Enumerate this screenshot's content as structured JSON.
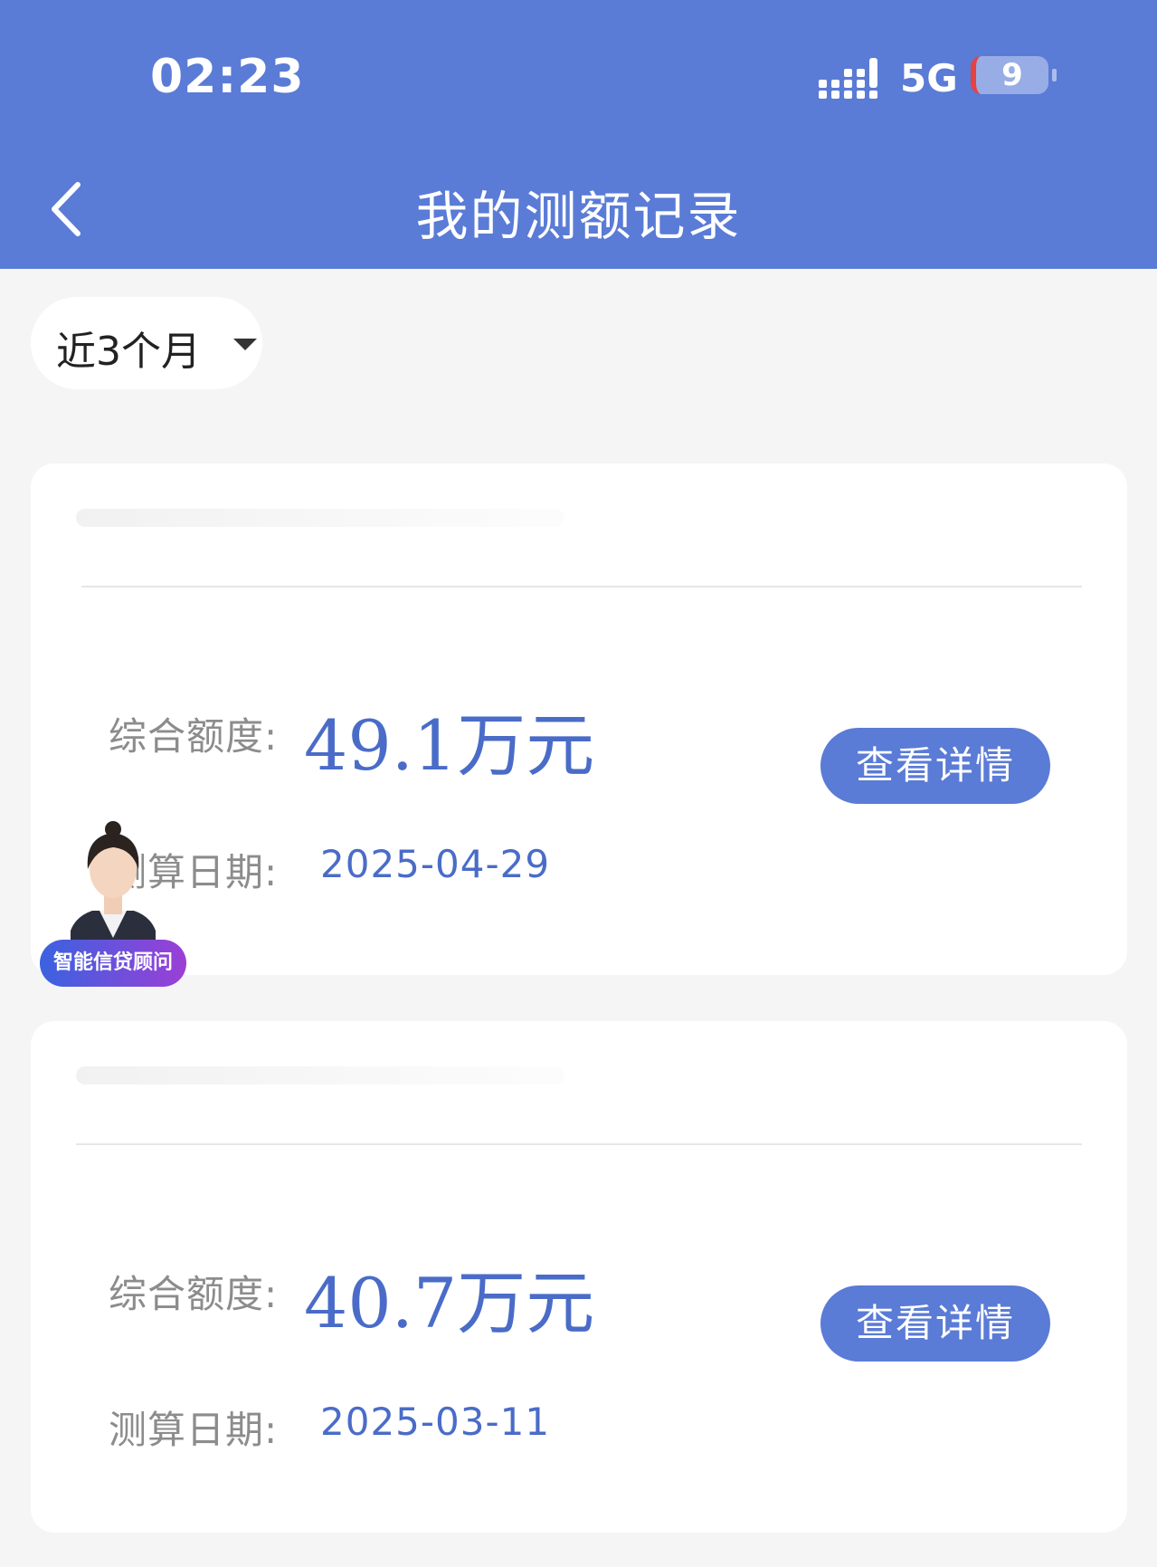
{
  "status_bar": {
    "time": "02:23",
    "network": "5G",
    "battery": "9"
  },
  "nav": {
    "title": "我的测额记录"
  },
  "filter": {
    "label": "近3个月"
  },
  "records": [
    {
      "amount_label": "综合额度:",
      "amount": "49.1万元",
      "date_label": "测算日期:",
      "date": "2025-04-29",
      "button": "查看详情"
    },
    {
      "amount_label": "综合额度:",
      "amount": "40.7万元",
      "date_label": "测算日期:",
      "date": "2025-03-11",
      "button": "查看详情"
    }
  ],
  "advisor": {
    "badge": "智能信贷顾问"
  },
  "colors": {
    "primary": "#5a7bd6",
    "accent_text": "#4a6cc8",
    "background": "#f5f5f5"
  }
}
